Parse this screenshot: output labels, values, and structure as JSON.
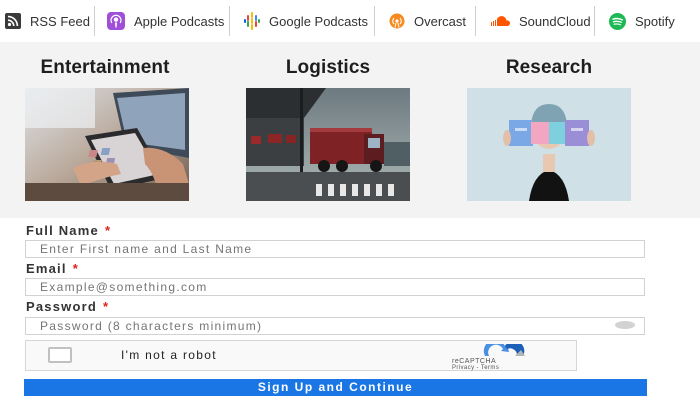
{
  "podcasts": [
    {
      "label": "RSS Feed",
      "icon": "rss-icon"
    },
    {
      "label": "Apple Podcasts",
      "icon": "apple-podcasts-icon"
    },
    {
      "label": "Google Podcasts",
      "icon": "google-podcasts-icon"
    },
    {
      "label": "Overcast",
      "icon": "overcast-icon"
    },
    {
      "label": "SoundCloud",
      "icon": "soundcloud-icon"
    },
    {
      "label": "Spotify",
      "icon": "spotify-icon"
    }
  ],
  "categories": [
    {
      "title": "Entertainment"
    },
    {
      "title": "Logistics"
    },
    {
      "title": "Research"
    }
  ],
  "form": {
    "full_name": {
      "label": "Full Name",
      "required": "*",
      "placeholder": "Enter First name and Last Name"
    },
    "email": {
      "label": "Email",
      "required": "*",
      "placeholder": "Example@something.com"
    },
    "password": {
      "label": "Password",
      "required": "*",
      "placeholder": "Password (8 characters minimum)"
    },
    "captcha": {
      "text": "I'm not a robot",
      "brand": "reCAPTCHA",
      "links": "Privacy - Terms"
    },
    "submit_label": "Sign Up and Continue"
  },
  "colors": {
    "accent": "#1976e4",
    "required": "#e0211a",
    "band_background": "#f3f3f3",
    "apple": "#a04fd8",
    "overcast": "#f68a1e",
    "soundcloud": "#ff5500",
    "spotify": "#1db954"
  }
}
